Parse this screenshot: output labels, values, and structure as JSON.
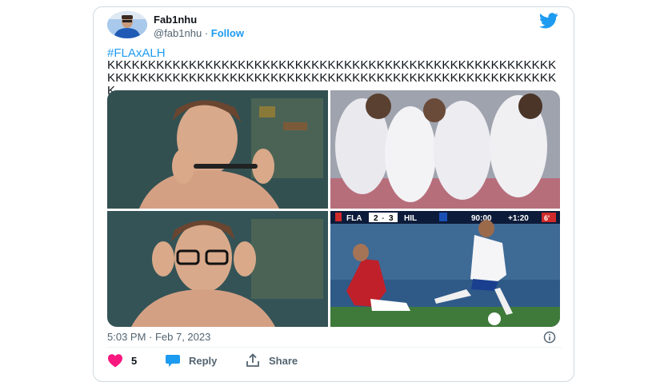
{
  "tweet": {
    "author_name": "Fab1nhu",
    "author_handle": "@fab1nhu",
    "separator": "·",
    "follow_label": "Follow",
    "hashtag": "#FLAxALH",
    "text": "KKKKKKKKKKKKKKKKKKKKKKKKKKKKKKKKKKKKKKKKKKKKKKKKKKKKKKKKKKKKKKKKKKKKKKKKKKKKKKKKKKKKKKKKKKKKKKKKKKKKKKKKKKKKKKK",
    "timestamp": "5:03 PM · Feb 7, 2023",
    "likes_count": "5",
    "reply_label": "Reply",
    "share_label": "Share"
  },
  "media": {
    "scoreboard": {
      "home": "FLA",
      "home_score": "2",
      "score_sep": "-",
      "away_score": "3",
      "away": "HIL",
      "clock": "90:00",
      "added_time": "+1:20",
      "extra": "6'"
    }
  },
  "colors": {
    "accent": "#1d9bf0",
    "like": "#f91880",
    "text_secondary": "#536471",
    "border": "#cfd9de"
  },
  "icons": {
    "brand": "twitter-bird-icon",
    "like": "heart-icon",
    "reply": "reply-bubble-icon",
    "share": "share-icon",
    "info": "info-icon"
  }
}
